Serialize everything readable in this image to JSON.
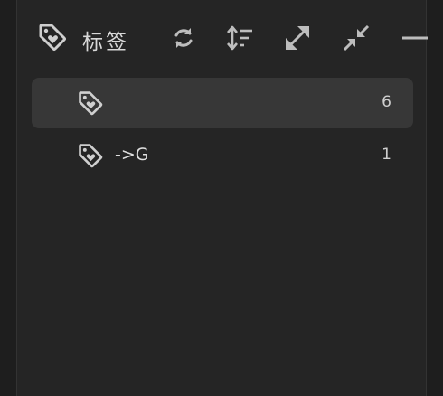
{
  "header": {
    "title": "标签",
    "title_icon": "tag-heart-icon",
    "tools": [
      {
        "name": "refresh",
        "icon": "refresh-icon"
      },
      {
        "name": "sort",
        "icon": "sort-icon"
      },
      {
        "name": "expand",
        "icon": "expand-icon"
      },
      {
        "name": "collapse",
        "icon": "collapse-icon"
      },
      {
        "name": "minimize",
        "icon": "minus-icon"
      }
    ]
  },
  "tags": [
    {
      "label": "",
      "count": "6",
      "selected": true,
      "icon": "tag-heart-icon"
    },
    {
      "label": "->G",
      "count": "1",
      "selected": false,
      "icon": "tag-heart-icon"
    }
  ],
  "colors": {
    "panel_bg": "#252525",
    "outer_bg": "#1e1e1e",
    "selected_row_bg": "#373737",
    "icon_color": "#cfcfcf",
    "text_color": "#e0e0e0"
  }
}
